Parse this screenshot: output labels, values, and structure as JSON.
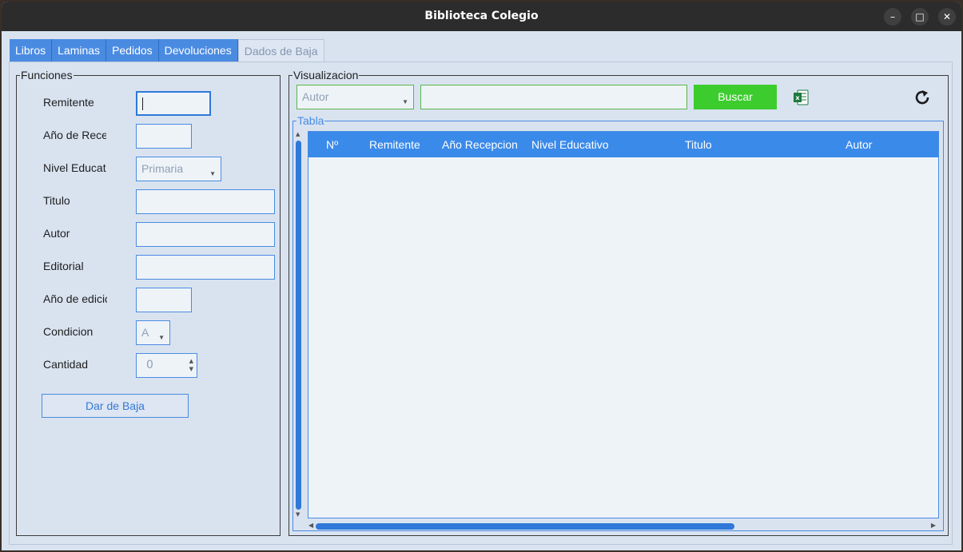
{
  "window": {
    "title": "Biblioteca Colegio",
    "minimize_icon": "minimize-icon",
    "maximize_icon": "maximize-icon",
    "close_icon": "close-icon"
  },
  "tabs": [
    {
      "label": "Libros",
      "active": false
    },
    {
      "label": "Laminas",
      "active": false
    },
    {
      "label": "Pedidos",
      "active": false
    },
    {
      "label": "Devoluciones",
      "active": false
    },
    {
      "label": "Dados de Baja",
      "active": true
    }
  ],
  "funciones": {
    "legend": "Funciones",
    "remitente_label": "Remitente",
    "remitente_value": "",
    "anio_recepcion_label": "Año de Recepcion",
    "anio_recepcion_value": "",
    "nivel_label": "Nivel Educativo",
    "nivel_value": "Primaria",
    "titulo_label": "Titulo",
    "titulo_value": "",
    "autor_label": "Autor",
    "autor_value": "",
    "editorial_label": "Editorial",
    "editorial_value": "",
    "anio_edicion_label": "Año de edicion",
    "anio_edicion_value": "",
    "condicion_label": "Condicion",
    "condicion_value": "A",
    "cantidad_label": "Cantidad",
    "cantidad_value": "0",
    "dar_de_baja_button": "Dar de Baja"
  },
  "visualizacion": {
    "legend": "Visualizacion",
    "filter_value": "Autor",
    "search_value": "",
    "buscar_button": "Buscar",
    "excel_icon": "excel-icon",
    "refresh_icon": "refresh-icon"
  },
  "tabla": {
    "legend": "Tabla",
    "columns": [
      "Nº",
      "Remitente",
      "Año Recepcion",
      "Nivel Educativo",
      "Titulo",
      "Autor"
    ],
    "rows": []
  },
  "colors": {
    "accent": "#3a8aea",
    "buscar": "#3ccc2e",
    "background": "#d9e3f0"
  }
}
